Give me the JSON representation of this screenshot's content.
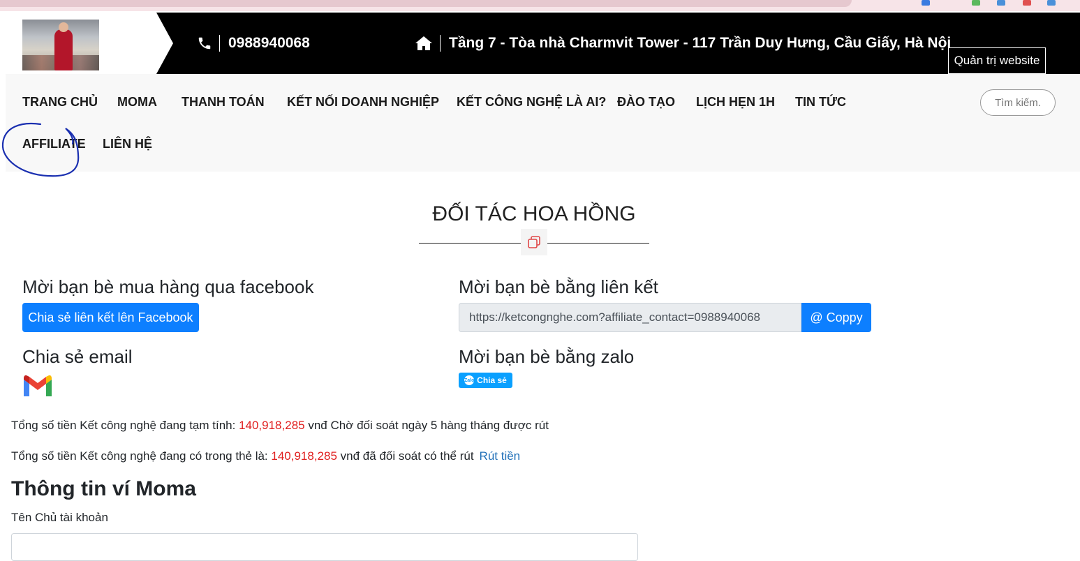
{
  "header": {
    "phone": "0988940068",
    "address": "Tầng 7 - Tòa nhà Charmvit Tower - 117 Trần Duy Hưng, Cầu Giấy, Hà Nội",
    "admin_tooltip": "Quản trị website"
  },
  "nav": {
    "items": [
      {
        "label": "TRANG CHỦ"
      },
      {
        "label": "MOMA"
      },
      {
        "label": "THANH TOÁN"
      },
      {
        "label": "KẾT NỐI DOANH NGHIỆP"
      },
      {
        "label": "KẾT CÔNG NGHỆ LÀ AI?"
      },
      {
        "label": "ĐÀO TẠO"
      },
      {
        "label": "LỊCH HẸN 1H"
      },
      {
        "label": "TIN TỨC"
      },
      {
        "label": "AFFILIATE"
      },
      {
        "label": "LIÊN HỆ"
      }
    ],
    "search_placeholder": "Tìm kiếm."
  },
  "page": {
    "title": "ĐỐI TÁC HOA HỒNG"
  },
  "share": {
    "facebook_heading": "Mời bạn bè mua hàng qua facebook",
    "facebook_button": "Chia sẻ liên kết lên Facebook",
    "link_heading": "Mời bạn bè bằng liên kết",
    "link_value": "https://ketcongnghe.com?affiliate_contact=0988940068",
    "copy_button": "@ Coppy",
    "email_heading": "Chia sẻ email",
    "zalo_heading": "Mời bạn bè bằng zalo",
    "zalo_button": "Chia sẻ"
  },
  "balance": {
    "pending_prefix": "Tổng số tiền Kết công nghệ đang tạm tính: ",
    "pending_amount": "140,918,285",
    "pending_suffix": " vnđ Chờ đối soát ngày 5 hàng tháng được rút",
    "available_prefix": "Tổng số tiền Kết công nghệ đang có trong thẻ là: ",
    "available_amount": "140,918,285",
    "available_suffix": " vnđ đã đối soát có thể rút",
    "withdraw_link": "Rút tiền"
  },
  "wallet": {
    "title": "Thông tin ví Moma",
    "owner_label": "Tên Chủ tài khoản",
    "owner_value": ""
  },
  "colors": {
    "primary": "#0d7fff",
    "amount_red": "#e01e1e",
    "annotation_circle": "#1a2fb0",
    "topbar": "#000000"
  }
}
